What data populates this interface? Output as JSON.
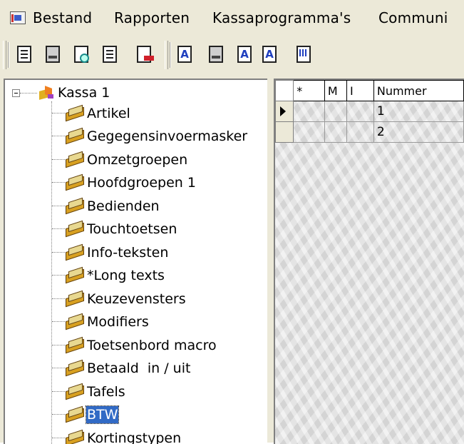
{
  "menu": {
    "items": [
      {
        "label": "Bestand"
      },
      {
        "label": "Rapporten"
      },
      {
        "label": "Kassaprogramma's"
      },
      {
        "label": "Communi"
      }
    ]
  },
  "toolbar": {
    "buttons": [
      {
        "icon": "document-icon"
      },
      {
        "icon": "print-icon"
      },
      {
        "icon": "print-preview-icon"
      },
      {
        "icon": "properties-icon"
      },
      {
        "icon": "exit-icon"
      },
      {
        "icon": "letter-a-icon",
        "glyph": "A"
      },
      {
        "icon": "print-list-icon"
      },
      {
        "icon": "letter-a-arrow-icon",
        "glyph": "A"
      },
      {
        "icon": "letter-a-exit-icon",
        "glyph": "A"
      },
      {
        "icon": "grid-export-icon"
      }
    ]
  },
  "tree": {
    "root": {
      "label": "Kassa 1",
      "expanded": true
    },
    "items": [
      {
        "label": "Artikel"
      },
      {
        "label": "Gegegensinvoermasker"
      },
      {
        "label": "Omzetgroepen"
      },
      {
        "label": "Hoofdgroepen 1"
      },
      {
        "label": "Bedienden"
      },
      {
        "label": "Touchtoetsen"
      },
      {
        "label": "Info-teksten"
      },
      {
        "label": "*Long texts"
      },
      {
        "label": "Keuzevensters"
      },
      {
        "label": "Modifiers"
      },
      {
        "label": "Toetsenbord macro"
      },
      {
        "label": "Betaald  in / uit"
      },
      {
        "label": "Tafels"
      },
      {
        "label": "BTW",
        "selected": true
      },
      {
        "label": "Kortingstypen"
      }
    ]
  },
  "grid": {
    "columns": [
      "*",
      "M",
      "I",
      "Nummer"
    ],
    "rows": [
      {
        "star": "",
        "m": "",
        "i": "",
        "nummer": "1",
        "current": true
      },
      {
        "star": "",
        "m": "",
        "i": "",
        "nummer": "2",
        "current": false
      }
    ]
  }
}
